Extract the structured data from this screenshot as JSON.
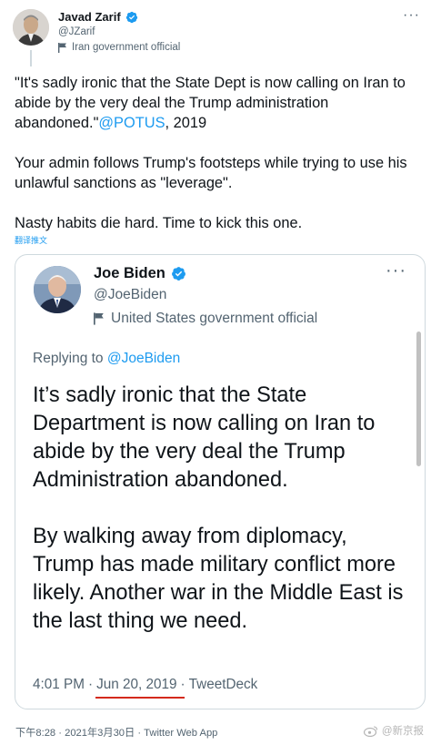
{
  "tweet": {
    "author_name": "Javad Zarif",
    "author_handle": "@JZarif",
    "author_label": "Iran government official",
    "paragraph1_pre": "\"It's sadly ironic that the State Dept is now calling on Iran to abide by the very deal the Trump administration abandoned.\"",
    "paragraph1_link": "@POTUS",
    "paragraph1_post": ", 2019",
    "paragraph2": "Your admin follows Trump's footsteps while trying to use his unlawful sanctions as \"leverage\".",
    "paragraph3": "Nasty habits die hard. Time to kick this one.",
    "translate": "翻译推文",
    "footer": "下午8:28 · 2021年3月30日 · Twitter Web App"
  },
  "quoted": {
    "author_name": "Joe Biden",
    "author_handle": "@JoeBiden",
    "author_label": "United States government official",
    "replying_prefix": "Replying to ",
    "replying_handle": "@JoeBiden",
    "paragraph1": "It’s sadly ironic that the State Department is now calling on Iran to abide by the very deal the Trump Administration abandoned.",
    "paragraph2": "By walking away from diplomacy, Trump has made military conflict more likely. Another war in the Middle East is the last thing we need.",
    "time": "4:01 PM",
    "sep1": "·",
    "date": "Jun 20, 2019",
    "sep2": "·",
    "source": "TweetDeck"
  },
  "watermark": "@新京报",
  "colors": {
    "link": "#1d9bf0",
    "verified": "#1d9bf0",
    "underline_annotation": "#d42a1c"
  }
}
